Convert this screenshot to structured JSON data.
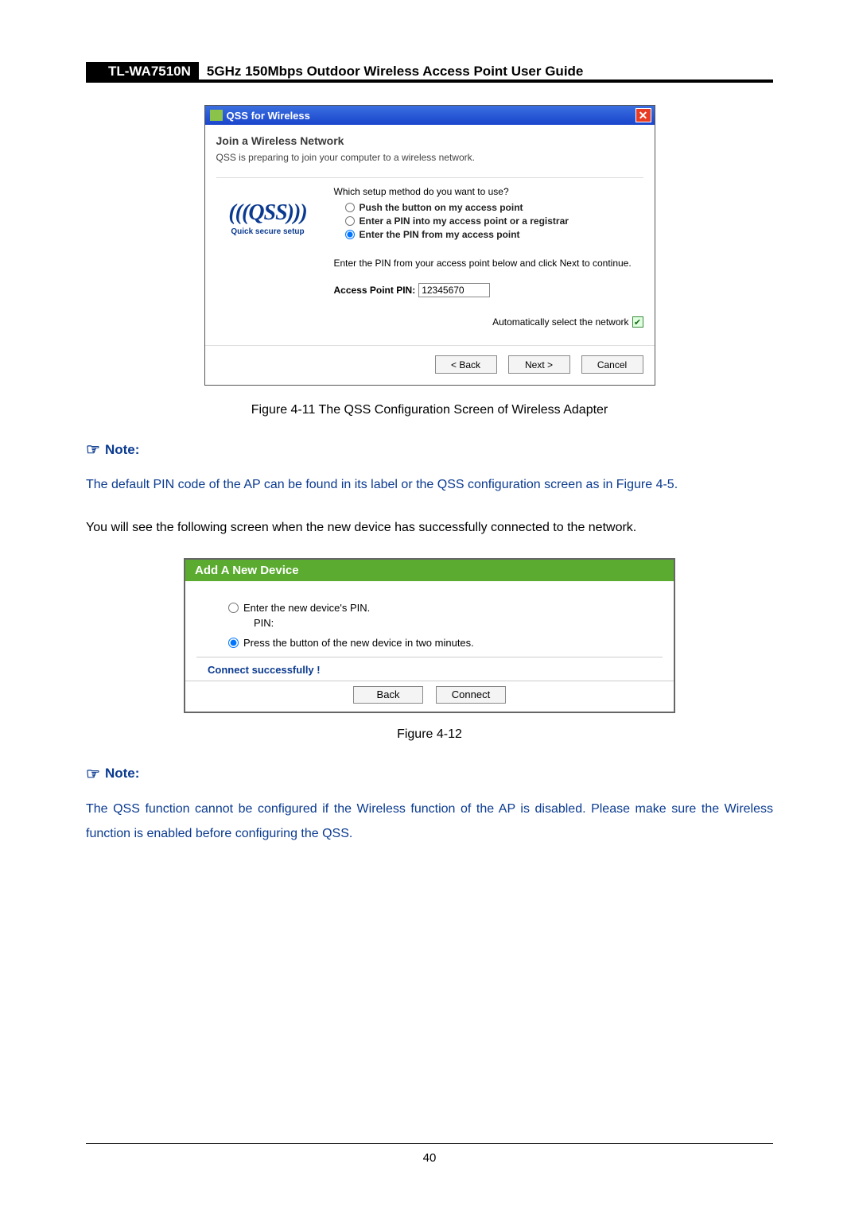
{
  "header": {
    "model": "TL-WA7510N",
    "title": "5GHz 150Mbps Outdoor Wireless Access Point User Guide"
  },
  "qss": {
    "window_title": "QSS for Wireless",
    "heading": "Join a Wireless Network",
    "subtext": "QSS is preparing to join your computer to a wireless network.",
    "logo_text": "(((QSS)))",
    "logo_caption": "Quick secure setup",
    "question": "Which setup method do you want to use?",
    "options": {
      "push": "Push the button on my access point",
      "enter_pin_reg": "Enter a PIN into my access point or a registrar",
      "enter_pin_ap": "Enter the PIN from my access point"
    },
    "instruction": "Enter the PIN from your access point below and click Next to continue.",
    "pin_label": "Access Point PIN:",
    "pin_value": "12345670",
    "auto_select": "Automatically select the network",
    "buttons": {
      "back": "< Back",
      "next": "Next >",
      "cancel": "Cancel"
    }
  },
  "captions": {
    "fig411": "Figure 4-11 The QSS Configuration Screen of Wireless Adapter",
    "fig412": "Figure 4-12"
  },
  "notes": {
    "label": "Note:",
    "note1": "The default PIN code of the AP can be found in its label or the QSS configuration screen as in Figure 4-5.",
    "transition": "You will see the following screen when the new device has successfully connected to the network.",
    "note2": "The QSS function cannot be configured if the Wireless function of the AP is disabled. Please make sure the Wireless function is enabled before configuring the QSS."
  },
  "adddev": {
    "title": "Add A New Device",
    "opt_pin": "Enter the new device's PIN.",
    "pin_label": "PIN:",
    "opt_press": "Press the button of the new device in two minutes.",
    "status": "Connect successfully !",
    "buttons": {
      "back": "Back",
      "connect": "Connect"
    }
  },
  "page_number": "40"
}
